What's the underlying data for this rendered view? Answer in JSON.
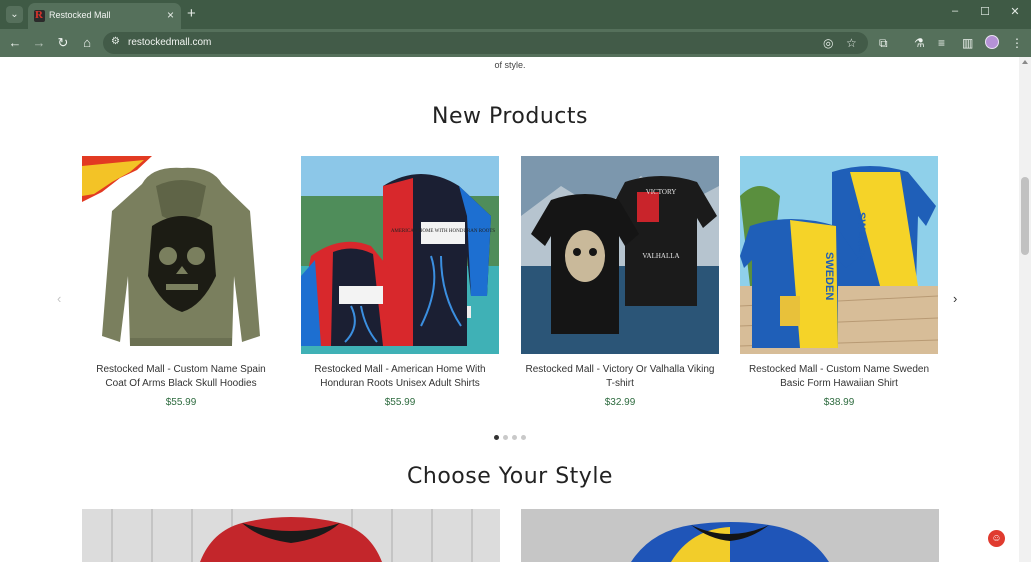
{
  "browser": {
    "tab_title": "Restocked Mall",
    "url": "restockedmall.com",
    "icons": {
      "tab_menu": "chevron-down-icon",
      "close": "close-icon",
      "new_tab": "plus-icon",
      "back": "back-arrow-icon",
      "forward": "forward-arrow-icon",
      "reload": "reload-icon",
      "home": "home-icon",
      "site_info": "site-settings-icon",
      "eye_off": "eye-off-icon",
      "star": "star-icon",
      "extensions": "puzzle-icon",
      "labs": "flask-icon",
      "media": "media-icon",
      "sidepanel": "side-panel-icon",
      "menu": "more-vert-icon"
    }
  },
  "page": {
    "intro_tail": "of style.",
    "new_products_title": "New Products",
    "choose_style_title": "Choose Your Style",
    "products": [
      {
        "name": "Restocked Mall - Custom Name Spain Coat Of Arms Black Skull Hoodies",
        "price": "$55.99"
      },
      {
        "name": "Restocked Mall - American Home With Honduran Roots Unisex Adult Shirts",
        "price": "$55.99"
      },
      {
        "name": "Restocked Mall - Victory Or Valhalla Viking T-shirt",
        "price": "$32.99"
      },
      {
        "name": "Restocked Mall - Custom Name Sweden Basic Form Hawaiian Shirt",
        "price": "$38.99"
      }
    ],
    "product_image_text": {
      "honduras_print": "AMERICAN HOME WITH HONDURAN ROOTS",
      "viking_top": "VICTORY",
      "viking_bottom": "VALHALLA",
      "sweden_print": "SWEDEN"
    },
    "carousel_dots": 4,
    "carousel_active_dot": 0
  },
  "colors": {
    "chrome_dark": "#3f5a45",
    "chrome_light": "#55705b",
    "price_green": "#2e6b3f",
    "accent_red": "#e03b2f"
  }
}
